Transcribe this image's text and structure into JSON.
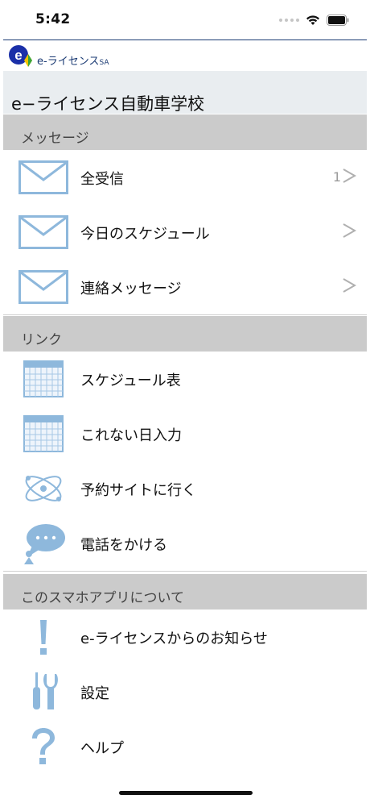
{
  "status": {
    "time": "5:42"
  },
  "logo": {
    "text_main": "e-ライセンス",
    "text_sub": "SA"
  },
  "title": "e−ライセンス自動車学校",
  "sections": {
    "messages": "メッセージ",
    "links": "リンク",
    "about": "このスマホアプリについて"
  },
  "messages": [
    {
      "label": "全受信",
      "count": "1",
      "icon": "envelope-icon"
    },
    {
      "label": "今日のスケジュール",
      "count": "",
      "icon": "envelope-icon"
    },
    {
      "label": "連絡メッセージ",
      "count": "",
      "icon": "envelope-icon"
    }
  ],
  "links": [
    {
      "label": "スケジュール表",
      "icon": "calendar-icon"
    },
    {
      "label": "これない日入力",
      "icon": "calendar-icon"
    },
    {
      "label": "予約サイトに行く",
      "icon": "atom-icon"
    },
    {
      "label": "電話をかける",
      "icon": "speech-bubble-icon"
    }
  ],
  "about": [
    {
      "label": "e-ライセンスからのお知らせ",
      "icon": "exclamation-icon"
    },
    {
      "label": "設定",
      "icon": "tools-icon"
    },
    {
      "label": "ヘルプ",
      "icon": "question-icon"
    }
  ],
  "colors": {
    "accent": "#8eb8dc",
    "header_line": "#1a3a73",
    "section_bg": "#cbcbcb",
    "title_bg": "#e9edf0"
  }
}
